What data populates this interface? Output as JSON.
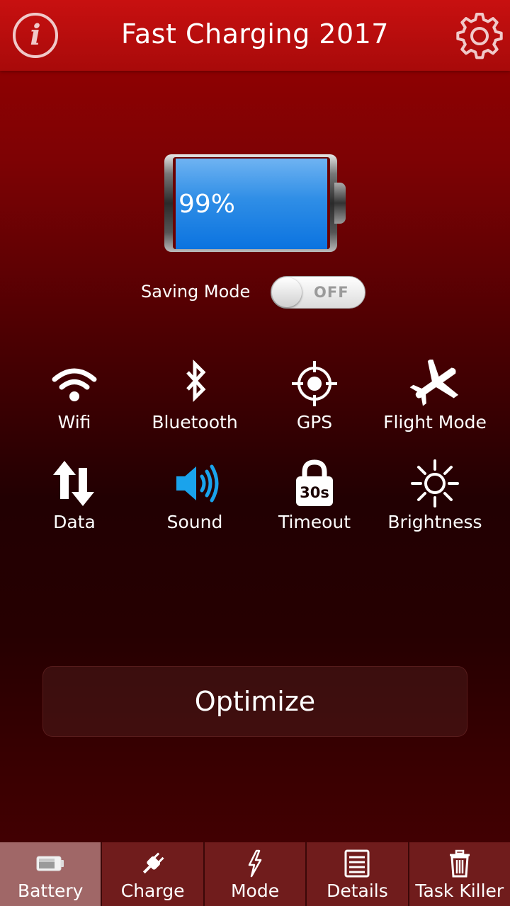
{
  "header": {
    "title": "Fast Charging 2017",
    "info_icon": "info-icon",
    "settings_icon": "gear-icon"
  },
  "battery": {
    "percent_text": "99%",
    "level": 0.99,
    "fill_color": "#1f84e6"
  },
  "saving_mode": {
    "label": "Saving Mode",
    "toggle_text": "OFF",
    "state": "off"
  },
  "quick_settings": [
    {
      "label": "Wifi",
      "icon": "wifi-icon"
    },
    {
      "label": "Bluetooth",
      "icon": "bluetooth-icon"
    },
    {
      "label": "GPS",
      "icon": "gps-icon"
    },
    {
      "label": "Flight Mode",
      "icon": "airplane-icon"
    },
    {
      "label": "Data",
      "icon": "data-arrows-icon"
    },
    {
      "label": "Sound",
      "icon": "speaker-icon"
    },
    {
      "label": "Timeout",
      "icon": "lock-timer-icon",
      "badge": "30s"
    },
    {
      "label": "Brightness",
      "icon": "sun-icon"
    }
  ],
  "optimize_button": {
    "label": "Optimize"
  },
  "tabs": [
    {
      "label": "Battery",
      "icon": "battery-icon",
      "active": true
    },
    {
      "label": "Charge",
      "icon": "plug-icon",
      "active": false
    },
    {
      "label": "Mode",
      "icon": "lightning-icon",
      "active": false
    },
    {
      "label": "Details",
      "icon": "document-icon",
      "active": false
    },
    {
      "label": "Task Killer",
      "icon": "trash-icon",
      "active": false
    }
  ],
  "colors": {
    "header": "#b50d0d",
    "accent_sound": "#1aa3ec",
    "tab_active": "#a06767",
    "tab_inactive": "#701c1c"
  }
}
